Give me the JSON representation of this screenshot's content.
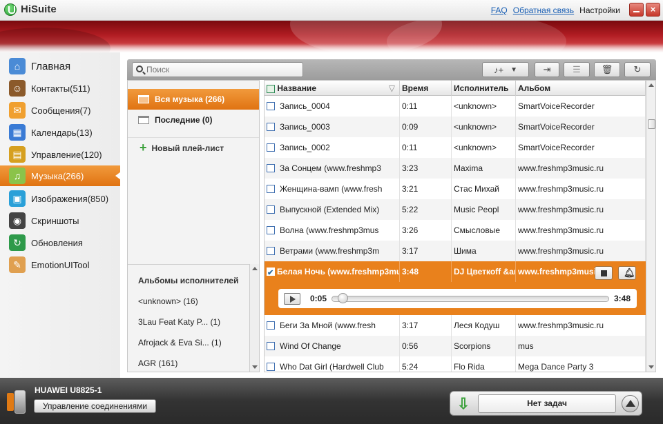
{
  "window": {
    "title": "HiSuite",
    "links": {
      "faq": "FAQ",
      "feedback": "Обратная связь",
      "settings": "Настройки"
    },
    "close_glyph": "×"
  },
  "sidebar": {
    "items": [
      {
        "label": "Главная",
        "icon": "home-icon",
        "color": "#4a8bd6"
      },
      {
        "label": "Контакты(511)",
        "icon": "contacts-icon",
        "color": "#8b5a2b"
      },
      {
        "label": "Сообщения(7)",
        "icon": "messages-icon",
        "color": "#f0a030"
      },
      {
        "label": "Календарь(13)",
        "icon": "calendar-icon",
        "color": "#3a7bd5"
      },
      {
        "label": "Управление(120)",
        "icon": "apps-icon",
        "color": "#d6a020"
      },
      {
        "label": "Музыка(266)",
        "icon": "music-icon",
        "color": "#8bc34a",
        "active": true
      },
      {
        "label": "Изображения(850)",
        "icon": "images-icon",
        "color": "#2aa0d8"
      },
      {
        "label": "Скриншоты",
        "icon": "camera-icon",
        "color": "#444444"
      },
      {
        "label": "Обновления",
        "icon": "update-icon",
        "color": "#2e9a4a"
      },
      {
        "label": "EmotionUITool",
        "icon": "palette-icon",
        "color": "#e0a050"
      }
    ]
  },
  "search": {
    "placeholder": "Поиск"
  },
  "toolbar": {
    "add_music_icon": "add-music-icon",
    "export_icon": "export-icon",
    "delete_disabled_icon": "remove-icon",
    "trash_icon": "trash-icon",
    "refresh_icon": "refresh-icon"
  },
  "playlists": {
    "items": [
      {
        "label": "Вся музыка (266)",
        "active": true
      },
      {
        "label": "Последние (0)"
      }
    ],
    "new_label": "Новый плей-лист",
    "albums_title": "Альбомы исполнителей",
    "albums": [
      "<unknown> (16)",
      "3Lau Feat Katy P... (1)",
      "Afrojack & Eva Si... (1)",
      "AGR (161)"
    ]
  },
  "table": {
    "columns": [
      "Название",
      "Время",
      "Исполнитель",
      "Альбом"
    ],
    "rows": [
      {
        "title": "Запись_0004",
        "time": "0:11",
        "artist": "<unknown>",
        "album": "SmartVoiceRecorder"
      },
      {
        "title": "Запись_0003",
        "time": "0:09",
        "artist": "<unknown>",
        "album": "SmartVoiceRecorder"
      },
      {
        "title": "Запись_0002",
        "time": "0:11",
        "artist": "<unknown>",
        "album": "SmartVoiceRecorder"
      },
      {
        "title": "За Сонцем (www.freshmp3",
        "time": "3:23",
        "artist": "Maxima",
        "album": "www.freshmp3music.ru"
      },
      {
        "title": "Женщина-вамп (www.fresh",
        "time": "3:21",
        "artist": "Стас Михай",
        "album": "www.freshmp3music.ru"
      },
      {
        "title": "Выпускной  (Extended Mix)",
        "time": "5:22",
        "artist": "Music Peopl",
        "album": "www.freshmp3music.ru"
      },
      {
        "title": "Волна (www.freshmp3mus",
        "time": "3:26",
        "artist": "Смысловые",
        "album": "www.freshmp3music.ru"
      },
      {
        "title": "Ветрами (www.freshmp3m",
        "time": "3:17",
        "artist": "Шима",
        "album": "www.freshmp3music.ru"
      }
    ],
    "playing": {
      "title": "Белая Ночь (www.freshmp3mu",
      "time": "3:48",
      "artist": "DJ Цветкоff &ar",
      "album": "www.freshmp3music.ru",
      "current": "0:05",
      "total": "3:48",
      "progress": 0.022
    },
    "rows_after": [
      {
        "title": "Беги За Мной (www.fresh",
        "time": "3:17",
        "artist": "Леся Кодуш",
        "album": "www.freshmp3music.ru"
      },
      {
        "title": "Wind Of Change",
        "time": "0:56",
        "artist": "Scorpions",
        "album": "mus"
      },
      {
        "title": "Who Dat Girl  (Hardwell Club",
        "time": "5:24",
        "artist": "Flo Rida",
        "album": "Mega Dance Party 3"
      }
    ]
  },
  "status": {
    "device": "HUAWEI U8825-1",
    "connection_button": "Управление соединениями",
    "tasks": "Нет задач"
  },
  "colors": {
    "accent": "#e9811c",
    "banner": "#b01c22"
  }
}
